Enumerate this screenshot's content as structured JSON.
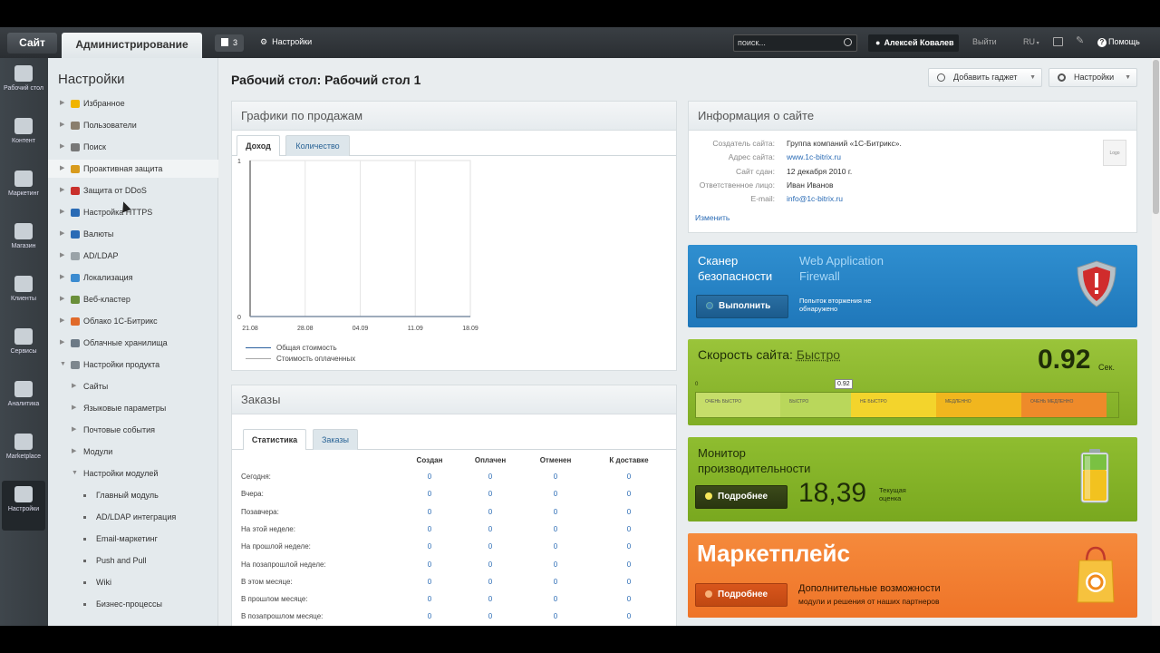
{
  "topbar": {
    "site": "Сайт",
    "admin": "Администрирование",
    "notifications": "3",
    "settings": "Настройки",
    "search_placeholder": "поиск...",
    "user": "Алексей Ковалев",
    "logout": "Выйти",
    "lang": "RU",
    "help": "Помощь"
  },
  "leftnav": [
    {
      "label": "Рабочий стол",
      "icon": "home-icon"
    },
    {
      "label": "Контент",
      "icon": "document-icon"
    },
    {
      "label": "Маркетинг",
      "icon": "target-icon"
    },
    {
      "label": "Магазин",
      "icon": "basket-icon"
    },
    {
      "label": "Клиенты",
      "icon": "clients-icon"
    },
    {
      "label": "Сервисы",
      "icon": "layers-icon"
    },
    {
      "label": "Аналитика",
      "icon": "bar-chart-icon"
    },
    {
      "label": "Marketplace",
      "icon": "cloud-download-icon"
    },
    {
      "label": "Настройки",
      "icon": "gear-icon"
    }
  ],
  "sidebar": {
    "title": "Настройки",
    "items": [
      {
        "label": "Избранное",
        "icon": "star-icon",
        "color": "#f0b400"
      },
      {
        "label": "Пользователи",
        "icon": "users-icon",
        "color": "#8a7f6e"
      },
      {
        "label": "Поиск",
        "icon": "search-icon",
        "color": "#777777"
      },
      {
        "label": "Проактивная защита",
        "icon": "lock-icon",
        "color": "#d89b1d"
      },
      {
        "label": "Защита от DDoS",
        "icon": "shield-icon",
        "color": "#c9302c"
      },
      {
        "label": "Настройка HTTPS",
        "icon": "lock-blue-icon",
        "color": "#2a6bb5"
      },
      {
        "label": "Валюты",
        "icon": "currency-icon",
        "color": "#2a6bb5"
      },
      {
        "label": "AD/LDAP",
        "icon": "folder-icon",
        "color": "#9aa3a8"
      },
      {
        "label": "Локализация",
        "icon": "globe-icon",
        "color": "#3b8bd0"
      },
      {
        "label": "Веб-кластер",
        "icon": "server-icon",
        "color": "#6a8f3a"
      },
      {
        "label": "Облако 1С-Битрикс",
        "icon": "cloud-icon",
        "color": "#e06a2a"
      },
      {
        "label": "Облачные хранилища",
        "icon": "storage-icon",
        "color": "#6c7a86"
      },
      {
        "label": "Настройки продукта",
        "icon": "product-gear-icon",
        "color": "#7d878e"
      }
    ],
    "subitems": [
      "Сайты",
      "Языковые параметры",
      "Почтовые события",
      "Модули",
      "Настройки модулей"
    ],
    "modules": [
      "Главный модуль",
      "AD/LDAP интеграция",
      "Email-маркетинг",
      "Push and Pull",
      "Wiki",
      "Бизнес-процессы"
    ]
  },
  "page": {
    "title": "Рабочий стол: Рабочий стол 1",
    "add_gadget": "Добавить гаджет",
    "settings": "Настройки"
  },
  "sales": {
    "title": "Графики по продажам",
    "tabs": [
      "Доход",
      "Количество"
    ],
    "legend": [
      "Общая стоимость",
      "Стоимость оплаченных"
    ]
  },
  "chart_data": {
    "type": "line",
    "x": [
      "21.08",
      "28.08",
      "04.09",
      "11.09",
      "18.09"
    ],
    "ylim": [
      0,
      1
    ],
    "yticks": [
      "0",
      "1"
    ],
    "series": [
      {
        "name": "Общая стоимость",
        "values": [
          0,
          0,
          0,
          0,
          0
        ],
        "color": "#2a5f9e"
      },
      {
        "name": "Стоимость оплаченных",
        "values": [
          0,
          0,
          0,
          0,
          0
        ],
        "color": "#a8a8a8"
      }
    ]
  },
  "orders": {
    "title": "Заказы",
    "tabs": [
      "Статистика",
      "Заказы"
    ],
    "columns": [
      "Создан",
      "Оплачен",
      "Отменен",
      "К доставке"
    ],
    "rows": [
      {
        "label": "Сегодня:",
        "values": [
          "0",
          "0",
          "0",
          "0"
        ]
      },
      {
        "label": "Вчера:",
        "values": [
          "0",
          "0",
          "0",
          "0"
        ]
      },
      {
        "label": "Позавчера:",
        "values": [
          "0",
          "0",
          "0",
          "0"
        ]
      },
      {
        "label": "На этой неделе:",
        "values": [
          "0",
          "0",
          "0",
          "0"
        ]
      },
      {
        "label": "На прошлой неделе:",
        "values": [
          "0",
          "0",
          "0",
          "0"
        ]
      },
      {
        "label": "На позапрошлой неделе:",
        "values": [
          "0",
          "0",
          "0",
          "0"
        ]
      },
      {
        "label": "В этом месяце:",
        "values": [
          "0",
          "0",
          "0",
          "0"
        ]
      },
      {
        "label": "В прошлом месяце:",
        "values": [
          "0",
          "0",
          "0",
          "0"
        ]
      },
      {
        "label": "В позапрошлом месяце:",
        "values": [
          "0",
          "0",
          "0",
          "0"
        ]
      }
    ]
  },
  "site_info": {
    "title": "Информация о сайте",
    "rows": [
      {
        "key": "Создатель сайта:",
        "value": "Группа компаний «1С-Битрикс».",
        "link": false
      },
      {
        "key": "Адрес сайта:",
        "value": "www.1c-bitrix.ru",
        "link": true
      },
      {
        "key": "Сайт сдан:",
        "value": "12 декабря 2010 г.",
        "link": false
      },
      {
        "key": "Ответственное лицо:",
        "value": "Иван Иванов",
        "link": false
      },
      {
        "key": "E-mail:",
        "value": "info@1c-bitrix.ru",
        "link": true
      }
    ],
    "logo": "Logo",
    "edit": "Изменить"
  },
  "scanner": {
    "title": "Сканер безопасности",
    "waf": "Web Application Firewall",
    "button": "Выполнить",
    "status": "Попыток вторжения не обнаружено"
  },
  "speed": {
    "title": "Скорость сайта:",
    "status": "Быстро",
    "value": "0.92",
    "unit": "Сек.",
    "marker": "0.92",
    "marker_fraction": 0.35,
    "segments": [
      "ОЧЕНЬ БЫСТРО",
      "БЫСТРО",
      "НЕ БЫСТРО",
      "МЕДЛЕННО",
      "ОЧЕНЬ МЕДЛЕННО"
    ],
    "scale_start": "0"
  },
  "monitor": {
    "title": "Монитор производительности",
    "button": "Подробнее",
    "value": "18,39",
    "caption": "Текущая оценка"
  },
  "market": {
    "title": "Маркетплейс",
    "button": "Подробнее",
    "line1": "Дополнительные возможности",
    "line2": "модули и решения от наших партнеров"
  }
}
